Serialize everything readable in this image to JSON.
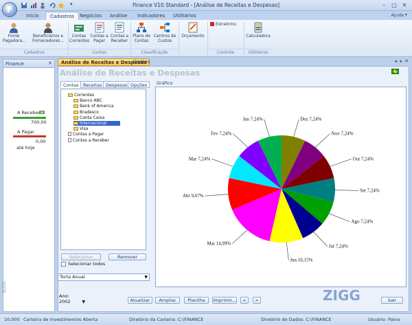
{
  "window": {
    "title": "Finance V10 Standard - [Análise de Receitas e Despesas]",
    "orb_letter": "F",
    "help_label": "Ajuda"
  },
  "ribbon": {
    "tabs": [
      "Início",
      "Cadastros",
      "Negócios",
      "Análise",
      "Indicadores",
      "Utilitários"
    ],
    "active_tab": "Cadastros",
    "buttons": {
      "fonte_pagadora": "Fonte Pagadora...",
      "beneficiarios": "Beneficiários e Fornecedores...",
      "contas_correntes": "Contas Correntes",
      "contas_pagar": "Contas a Pagar",
      "contas_receber": "Contas a Receber",
      "plano_contas": "Plano de Contas",
      "centros_custos": "Centros de Custos",
      "orcamento": "Orçamento",
      "estrelinho": "Estrelinho",
      "calculadora": "Calculadora"
    },
    "groups": {
      "cadastros": "Cadastros",
      "contas": "Contas",
      "classificacao": "Classificação",
      "controle": "Controle",
      "utilitarios": "Utilitários"
    }
  },
  "left_panel": {
    "title": "Finance",
    "receber_label": "A Receber",
    "receber_value": "700,00",
    "pagar_label": "A Pagar",
    "pagar_value": "0,00",
    "ate_hoje": "até hoje",
    "vertical_text": "ELCO"
  },
  "doc_tabs": [
    "Análise de Receitas e Despesas",
    "Contas"
  ],
  "document": {
    "heading": "Análise de Receitas e Despesas",
    "panel_tabs": [
      "Contas",
      "Receitas",
      "Despesas",
      "Opções"
    ],
    "grafico_label": "Gráfico",
    "tree": [
      {
        "label": "Correntes",
        "indent": 1,
        "icon": "folder"
      },
      {
        "label": "Banco ABC",
        "indent": 2,
        "icon": "folder"
      },
      {
        "label": "Bank of America",
        "indent": 2,
        "icon": "folder"
      },
      {
        "label": "Bradesco",
        "indent": 2,
        "icon": "folder"
      },
      {
        "label": "Conta Caixa",
        "indent": 2,
        "icon": "folder"
      },
      {
        "label": "Internacional",
        "indent": 2,
        "icon": "folder",
        "selected": true
      },
      {
        "label": "Visa",
        "indent": 2,
        "icon": "folder"
      },
      {
        "label": "Contas a Pagar",
        "indent": 1,
        "icon": "doc"
      },
      {
        "label": "Contas a Receber",
        "indent": 1,
        "icon": "doc"
      }
    ],
    "selecionar_button": "Selecionar",
    "remover_button": "Remover",
    "selecionar_todos": "Selecionar todos",
    "chart_type_select": "Torta Anual",
    "ano_label": "Ano:",
    "ano_value": "2002",
    "buttons": {
      "atualizar": "Atualizar",
      "ampliar": "Ampliar",
      "planilha": "Planilha",
      "imprimir": "Imprimir...",
      "prev": "<",
      "next": ">",
      "sair": "Sair"
    }
  },
  "status_bar": {
    "item1": "10.000",
    "item2": "Carteira de Investimentos Aberta",
    "item3": "Diretório da Carteira: C:\\FINANCE",
    "item4": "Diretório de Dados: C:\\FINANCE",
    "item5": "Usuário: Paiva"
  },
  "watermark": "ZIGG",
  "colors": {
    "ribbon_bg": "#dbe6f5",
    "active_doc_tab": "#ffc75a",
    "selection": "#3366cc"
  },
  "chart_data": {
    "type": "pie",
    "categories": [
      "Jan",
      "Fev",
      "Mar",
      "Abr",
      "Mai",
      "Jun",
      "Jul",
      "Ago",
      "Set",
      "Out",
      "Nov",
      "Dez"
    ],
    "values": [
      7.24,
      7.24,
      7.24,
      9.67,
      14.99,
      10.15,
      7.24,
      7.24,
      7.24,
      7.24,
      7.24,
      7.24
    ],
    "labels": [
      "Jan 7,24%",
      "Fev 7,24%",
      "Mar 7,24%",
      "Abr 9,67%",
      "Mai 14,99%",
      "Jun 10,15%",
      "Jul 7,24%",
      "Ago 7,24%",
      "Set 7,24%",
      "Out 7,24%",
      "Nov 7,24%",
      "Dez 7,24%"
    ],
    "colors": [
      "#00b050",
      "#7f00ff",
      "#00e8ff",
      "#ff0000",
      "#ff00ff",
      "#ffff00",
      "#000090",
      "#00a000",
      "#007f80",
      "#800000",
      "#800080",
      "#808000"
    ]
  }
}
